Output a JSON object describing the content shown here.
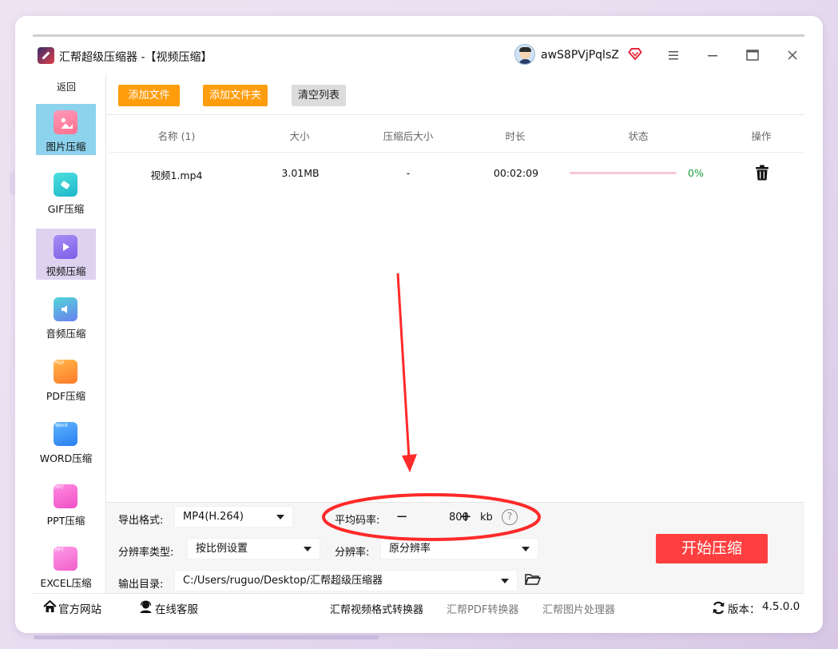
{
  "app": {
    "title": "汇帮超级压缩器  -【视频压缩】",
    "username": "awS8PVjPqlsZ"
  },
  "sidebar": {
    "back_label": "返回",
    "items": [
      {
        "label": "图片压缩",
        "icon": "image-icon"
      },
      {
        "label": "GIF压缩",
        "icon": "gif-icon"
      },
      {
        "label": "视频压缩",
        "icon": "video-icon"
      },
      {
        "label": "音频压缩",
        "icon": "audio-icon"
      },
      {
        "label": "PDF压缩",
        "icon": "pdf-icon",
        "tag": "PDF"
      },
      {
        "label": "WORD压缩",
        "icon": "word-icon",
        "tag": "Word"
      },
      {
        "label": "PPT压缩",
        "icon": "ppt-icon",
        "tag": "PPT"
      },
      {
        "label": "EXCEL压缩",
        "icon": "excel-icon",
        "tag": "PPT"
      }
    ]
  },
  "toolbar": {
    "add_file": "添加文件",
    "add_folder": "添加文件夹",
    "clear_list": "清空列表"
  },
  "table": {
    "headers": [
      "名称 (1)",
      "大小",
      "压缩后大小",
      "时长",
      "状态",
      "操作"
    ],
    "rows": [
      {
        "name": "视频1.mp4",
        "size": "3.01MB",
        "compressed_size": "-",
        "duration": "00:02:09",
        "progress_percent": 0,
        "progress_label": "0%"
      }
    ]
  },
  "settings": {
    "export_format_label": "导出格式:",
    "export_format_value": "MP4(H.264)",
    "bitrate_label": "平均码率:",
    "bitrate_minus": "−",
    "bitrate_value": "800",
    "bitrate_plus": "+",
    "bitrate_unit": "kb",
    "help_glyph": "?",
    "resolution_type_label": "分辨率类型:",
    "resolution_type_value": "按比例设置",
    "resolution_label": "分辨率:",
    "resolution_value": "原分辨率",
    "output_dir_label": "输出目录:",
    "output_dir_value": "C:/Users/ruguo/Desktop/汇帮超级压缩器",
    "start_button": "开始压缩"
  },
  "footer": {
    "website": "官方网站",
    "support": "在线客服",
    "link_video_converter": "汇帮视频格式转换器",
    "link_pdf_converter": "汇帮PDF转换器",
    "link_image_processor": "汇帮图片处理器",
    "version_label": "版本：",
    "version_value": "4.5.0.0"
  },
  "colors": {
    "orange_button": "#ff9d0d",
    "start_button": "#ff3f3f",
    "annotation_red": "#ff2a2a",
    "progress_green": "#1a9a3a"
  }
}
